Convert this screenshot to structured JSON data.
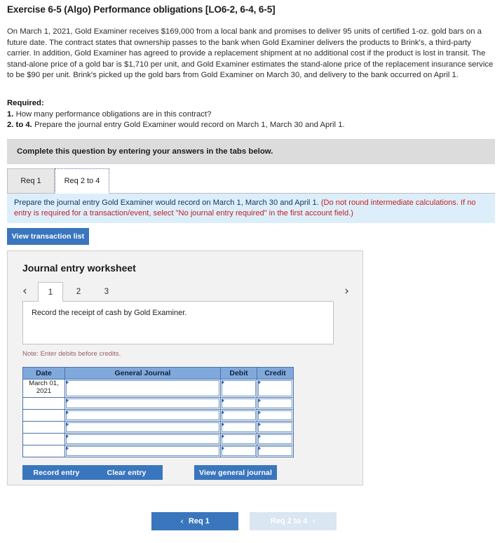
{
  "exercise": {
    "title": "Exercise 6-5 (Algo) Performance obligations [LO6-2, 6-4, 6-5]",
    "problem": "On March 1, 2021, Gold Examiner receives $169,000 from a local bank and promises to deliver 95 units of certified 1-oz. gold bars on a future date. The contract states that ownership passes to the bank when Gold Examiner delivers the products to Brink's, a third-party carrier. In addition, Gold Examiner has agreed to provide a replacement shipment at no additional cost if the product is lost in transit. The stand-alone price of a gold bar is $1,710 per unit, and Gold Examiner estimates the stand-alone price of the replacement insurance service to be $90 per unit. Brink's picked up the gold bars from Gold Examiner on March 30, and delivery to the bank occurred on April 1."
  },
  "required": {
    "heading": "Required:",
    "items": [
      {
        "num": "1.",
        "text": "How many performance obligations are in this contract?"
      },
      {
        "num": "2. to 4.",
        "text": "Prepare the journal entry Gold Examiner would record on March 1, March 30 and April 1."
      }
    ]
  },
  "complete_banner": {
    "text": "Complete this question by entering your answers in the tabs below."
  },
  "req_tabs": [
    {
      "label": "Req 1",
      "active": false
    },
    {
      "label": "Req 2 to 4",
      "active": true
    }
  ],
  "blue_banner": {
    "main": "Prepare the journal entry Gold Examiner would record on March 1, March 30 and April 1.",
    "note": "(Do not round intermediate calculations. If no entry is required for a transaction/event, select \"No journal entry required\" in the first account field.)"
  },
  "view_transaction_button": "View transaction list",
  "worksheet": {
    "title": "Journal entry worksheet",
    "pager": {
      "prev_icon": "chevron-left",
      "next_icon": "chevron-right",
      "prev_glyph": "‹",
      "next_glyph": "›",
      "pages": [
        "1",
        "2",
        "3"
      ],
      "active_page": "1"
    },
    "description": "Record the receipt of cash by Gold Examiner.",
    "note": "Note: Enter debits before credits.",
    "table": {
      "columns": [
        "Date",
        "General Journal",
        "Debit",
        "Credit"
      ],
      "rows": [
        {
          "date": "March 01, 2021",
          "general_journal": "",
          "debit": "",
          "credit": ""
        },
        {
          "date": "",
          "general_journal": "",
          "debit": "",
          "credit": ""
        },
        {
          "date": "",
          "general_journal": "",
          "debit": "",
          "credit": ""
        },
        {
          "date": "",
          "general_journal": "",
          "debit": "",
          "credit": ""
        },
        {
          "date": "",
          "general_journal": "",
          "debit": "",
          "credit": ""
        },
        {
          "date": "",
          "general_journal": "",
          "debit": "",
          "credit": ""
        }
      ]
    },
    "buttons": {
      "record": "Record entry",
      "clear": "Clear entry",
      "view_general_journal": "View general journal"
    }
  },
  "bottom_nav": {
    "prev_label": "Req 1",
    "next_label": "Req 2 to 4",
    "prev_glyph": "‹",
    "next_glyph": "›"
  },
  "colors": {
    "primary_blue": "#3a76bd",
    "table_header_blue": "#7fa9dd",
    "banner_blue": "#ddeefb",
    "banner_gray": "#dcdcdc",
    "panel_gray": "#f2f2f2",
    "red_note": "#c22222",
    "disabled_blue": "#dae6f2"
  }
}
